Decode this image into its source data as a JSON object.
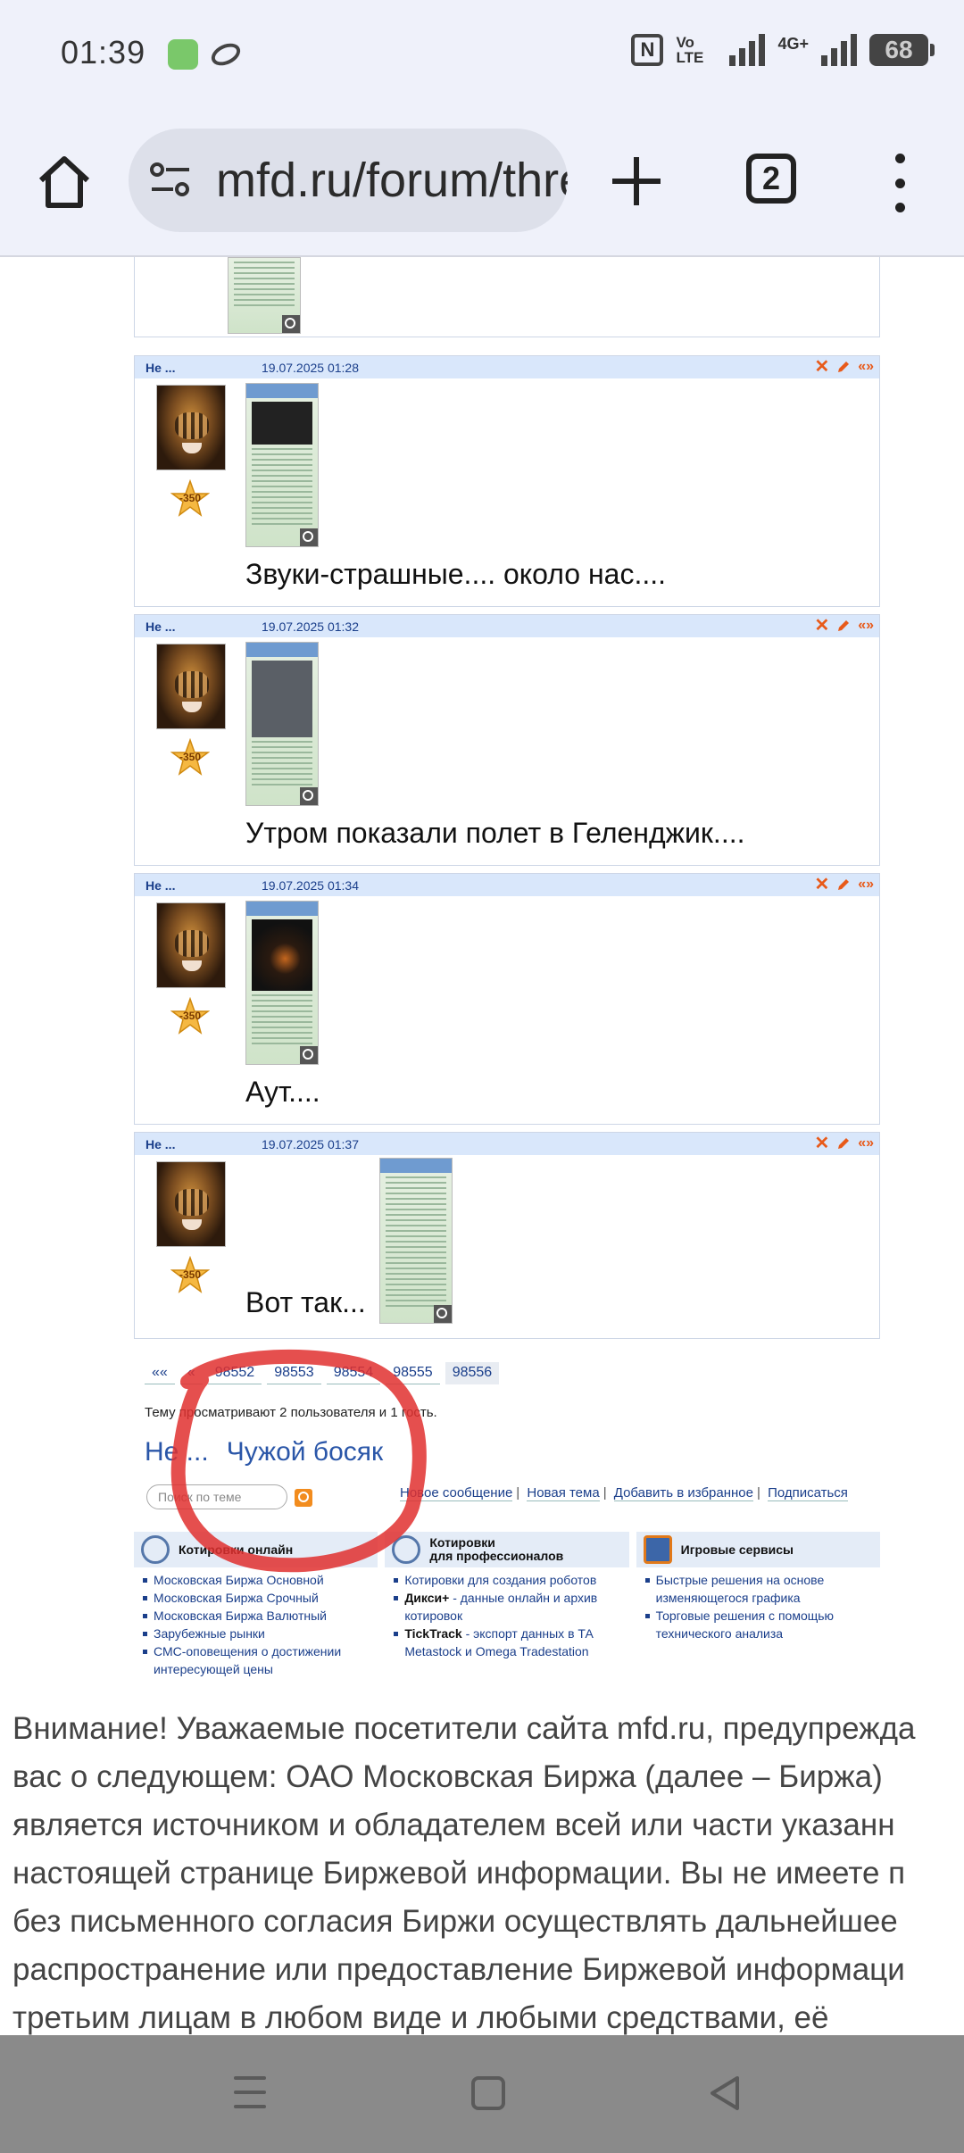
{
  "status_bar": {
    "time": "01:39",
    "volte_line1": "Vo",
    "volte_line2": "LTE",
    "network": "4G+",
    "battery": "68"
  },
  "browser": {
    "url": "mfd.ru/forum/thre",
    "tab_count": "2"
  },
  "posts": [
    {
      "author": "Не ...",
      "date": "19.07.2025 01:28",
      "rating": "-350",
      "text": "Звуки-страшные.... около нас...."
    },
    {
      "author": "Не ...",
      "date": "19.07.2025 01:32",
      "rating": "-350",
      "text": "Утром показали полет в Геленджик...."
    },
    {
      "author": "Не ...",
      "date": "19.07.2025 01:34",
      "rating": "-350",
      "text": "Аут...."
    },
    {
      "author": "Не ...",
      "date": "19.07.2025 01:37",
      "rating": "-350",
      "text": "Вот так..."
    }
  ],
  "pager": {
    "first": "««",
    "prev": "«",
    "pages": [
      "98552",
      "98553",
      "98554",
      "98555",
      "98556"
    ]
  },
  "viewers_text": "Тему просматривают 2 пользователя и 1 гость.",
  "viewer_users": [
    "Не ...",
    "Чужой босяк"
  ],
  "search_placeholder": "Поиск по теме",
  "actions": [
    "Новое сообщение",
    "Новая тема",
    "Добавить в избранное",
    "Подписаться"
  ],
  "services": [
    {
      "title": "Котировки онлайн",
      "items": [
        "Московская Биржа Основной",
        "Московская Биржа Срочный",
        "Московская Биржа Валютный",
        "Зарубежные рынки",
        "СМС-оповещения о достижении интересующей цены"
      ]
    },
    {
      "title_line1": "Котировки",
      "title_line2": "для профессионалов",
      "items": [
        {
          "text": "Котировки для создания роботов"
        },
        {
          "bold": "Дикси+",
          "text": " - данные онлайн и архив котировок"
        },
        {
          "bold": "TickTrack",
          "text": " - экспорт данных в ТА Metastock и Omega Tradestation"
        }
      ]
    },
    {
      "title": "Игровые сервисы",
      "items": [
        "Быстрые решения на основе изменяющегося графика",
        "Торговые решения с помощью технического анализа"
      ]
    }
  ],
  "disclaimer_lines": [
    "Внимание! Уважаемые посетители сайта mfd.ru, предупрежда",
    "вас о следующем: ОАО Московская Биржа (далее – Биржа)",
    "является источником и обладателем всей или части указанн",
    "настоящей странице Биржевой информации. Вы не имеете п",
    "без письменного согласия Биржи осуществлять дальнейшее",
    "распространение или предоставление Биржевой информаци",
    "третьим лицам в любом виде и любыми средствами, её"
  ],
  "colors": {
    "header_blue": "#d9e7fb",
    "link_blue": "#1b3f8b",
    "accent_orange": "#e85a1a",
    "annotation_red": "#e0302f"
  }
}
